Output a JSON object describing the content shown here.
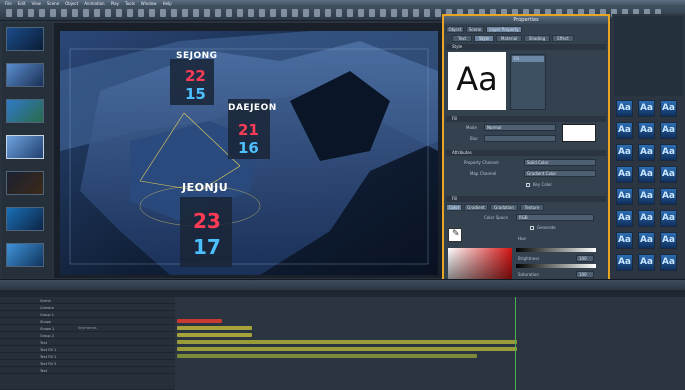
{
  "app": {
    "menu": [
      "File",
      "Edit",
      "View",
      "Scene",
      "Object",
      "Animation",
      "Play",
      "Tools",
      "Window",
      "Help"
    ]
  },
  "thumbnails": [
    {
      "label": ""
    },
    {
      "label": ""
    },
    {
      "label": ""
    },
    {
      "label": ""
    },
    {
      "label": ""
    },
    {
      "label": ""
    },
    {
      "label": ""
    }
  ],
  "viewport": {
    "cities": [
      {
        "name": "SEJONG",
        "red": "22",
        "blue": "15"
      },
      {
        "name": "DAEJEON",
        "red": "21",
        "blue": "16"
      },
      {
        "name": "JEONJU",
        "red": "23",
        "blue": "17"
      }
    ]
  },
  "properties_panel": {
    "title": "Properties",
    "top_tabs": [
      "Object",
      "Scene",
      "Layer Property"
    ],
    "sub_tabs": [
      "Text",
      "Style",
      "Material",
      "Shading",
      "Effect"
    ],
    "active_sub_tab": "Style",
    "font_preview": "Aa",
    "list_item": "Fill",
    "sections": {
      "style": "Style",
      "fill": "Fill",
      "alpha": "Attributes",
      "color": "Fill"
    },
    "fields": {
      "mode_label": "Mode",
      "mode_value": "Normal",
      "blur_label": "Blur",
      "prop_channel_label": "Property Channel",
      "prop_channel_value": "Solid Color",
      "map_channel_label": "Map Channel",
      "map_channel_value": "Gradient Color",
      "key_color_label": "Key Color",
      "color_space_label": "Color Space",
      "color_space_value": "RGB",
      "generate_label": "Generate",
      "hue_label": "Hue",
      "brightness_label": "Brightness",
      "brightness_value": "100",
      "saturation_label": "Saturation",
      "saturation_value": "100",
      "opacity_label": "Opacity",
      "opacity_value": "100"
    },
    "color_tabs": [
      "Color",
      "Gradient",
      "Gradation",
      "Texture"
    ],
    "colors": {
      "accent_border": "#e8a424",
      "picker_red": "#d41414"
    }
  },
  "style_gallery": {
    "swatches": [
      "Aa",
      "Aa",
      "Aa",
      "Aa",
      "Aa",
      "Aa",
      "Aa",
      "Aa",
      "Aa",
      "Aa",
      "Aa",
      "Aa",
      "Aa",
      "Aa",
      "Aa",
      "Aa",
      "Aa",
      "Aa",
      "Aa",
      "Aa",
      "Aa",
      "Aa",
      "Aa",
      "Aa"
    ]
  },
  "timeline": {
    "rows": [
      "Scene",
      "Camera",
      "Group 1",
      "Shape",
      "Shape 2",
      "Group 2",
      "Text",
      "Text Fill 1",
      "Text Fill 2",
      "Text Fill 3",
      "Text"
    ],
    "track_label": "Keyframes"
  }
}
